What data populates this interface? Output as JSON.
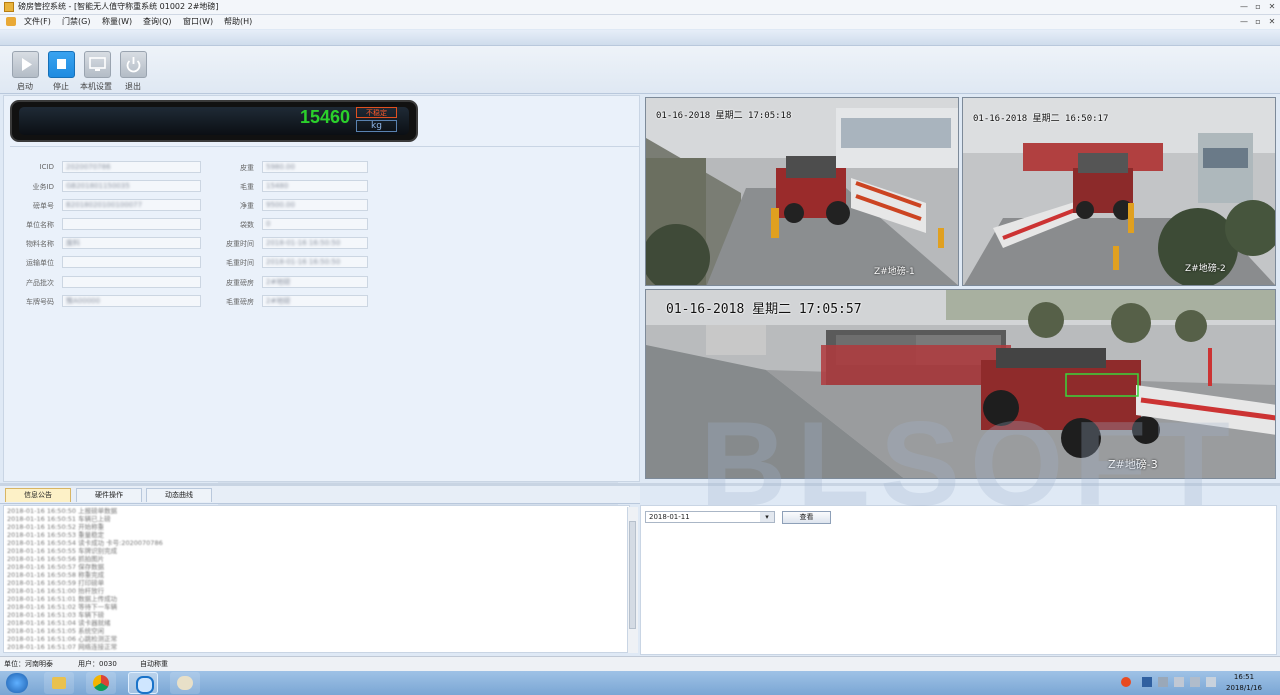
{
  "window": {
    "title": "磅房管控系统 - [智能无人值守称重系统 01002 2#地磅]",
    "controls": [
      "—",
      "▫",
      "✕"
    ],
    "mdi_controls": [
      "—",
      "▫",
      "✕"
    ]
  },
  "menu": {
    "items": [
      "文件(F)",
      "门禁(G)",
      "称量(W)",
      "查询(Q)",
      "窗口(W)",
      "帮助(H)"
    ]
  },
  "toolbar": {
    "start_label": "启动",
    "stop_label": "停止",
    "settings_label": "本机设置",
    "exit_label": "退出"
  },
  "scale": {
    "weight": "15460",
    "status": "不稳定",
    "unit": "kg"
  },
  "form": {
    "left_fields": [
      {
        "label": "ICID",
        "value": "2020070786"
      },
      {
        "label": "业务ID",
        "value": "GB201801150035"
      },
      {
        "label": "磅单号",
        "value": "B2018020100100077"
      },
      {
        "label": "单位名称",
        "value": ""
      },
      {
        "label": "物料名称",
        "value": "废料"
      },
      {
        "label": "运输单位",
        "value": ""
      },
      {
        "label": "产品批次",
        "value": ""
      },
      {
        "label": "车牌号码",
        "value": "豫A00000"
      }
    ],
    "right_fields": [
      {
        "label": "皮重",
        "value": "5980.00"
      },
      {
        "label": "毛重",
        "value": "15480"
      },
      {
        "label": "净重",
        "value": "9500.00"
      },
      {
        "label": "袋数",
        "value": "0"
      },
      {
        "label": "皮重时间",
        "value": "2018-01-16 16:50:50"
      },
      {
        "label": "毛重时间",
        "value": "2018-01-16 16:50:50"
      },
      {
        "label": "皮重磅房",
        "value": "2#地磅"
      },
      {
        "label": "毛重磅房",
        "value": "2#地磅"
      }
    ]
  },
  "cameras": [
    {
      "timestamp": "01-16-2018 星期二 17:05:18",
      "label": "Z#地磅-1"
    },
    {
      "timestamp": "01-16-2018 星期二 16:50:17",
      "label": "Z#地磅-2"
    },
    {
      "timestamp": "01-16-2018 星期二 17:05:57",
      "label": "Z#地磅-3"
    }
  ],
  "tabs": [
    "信息公告",
    "硬件操作",
    "动态曲线"
  ],
  "log": {
    "lines": [
      "2018-01-16 16:50:50 上报磅单数据",
      "2018-01-16 16:50:51 车辆已上磅",
      "2018-01-16 16:50:52 开始称重",
      "2018-01-16 16:50:53 重量稳定",
      "2018-01-16 16:50:54 读卡成功 卡号:2020070786",
      "2018-01-16 16:50:55 车牌识别完成",
      "2018-01-16 16:50:56 抓拍图片",
      "2018-01-16 16:50:57 保存数据",
      "2018-01-16 16:50:58 称重完成",
      "2018-01-16 16:50:59 打印磅单",
      "2018-01-16 16:51:00 抬杆放行",
      "2018-01-16 16:51:01 数据上传成功",
      "2018-01-16 16:51:02 等待下一车辆",
      "2018-01-16 16:51:03 车辆下磅",
      "2018-01-16 16:51:04 读卡器就绪",
      "2018-01-16 16:51:05 系统空闲",
      "2018-01-16 16:51:06 心跳检测正常",
      "2018-01-16 16:51:07 网络连接正常"
    ]
  },
  "query": {
    "date": "2018-01-11",
    "button": "查看"
  },
  "status": {
    "unit": "单位：河南明泰",
    "user": "用户：0030",
    "mode": "自动称重"
  },
  "taskbar": {
    "time": "16:51",
    "date": "2018/1/16"
  },
  "colors": {
    "weight_text": "#2bd02b",
    "unstable_text": "#ff5a2a",
    "active_tab": "#fdf1c7",
    "stop_button": "#1e8be0"
  }
}
